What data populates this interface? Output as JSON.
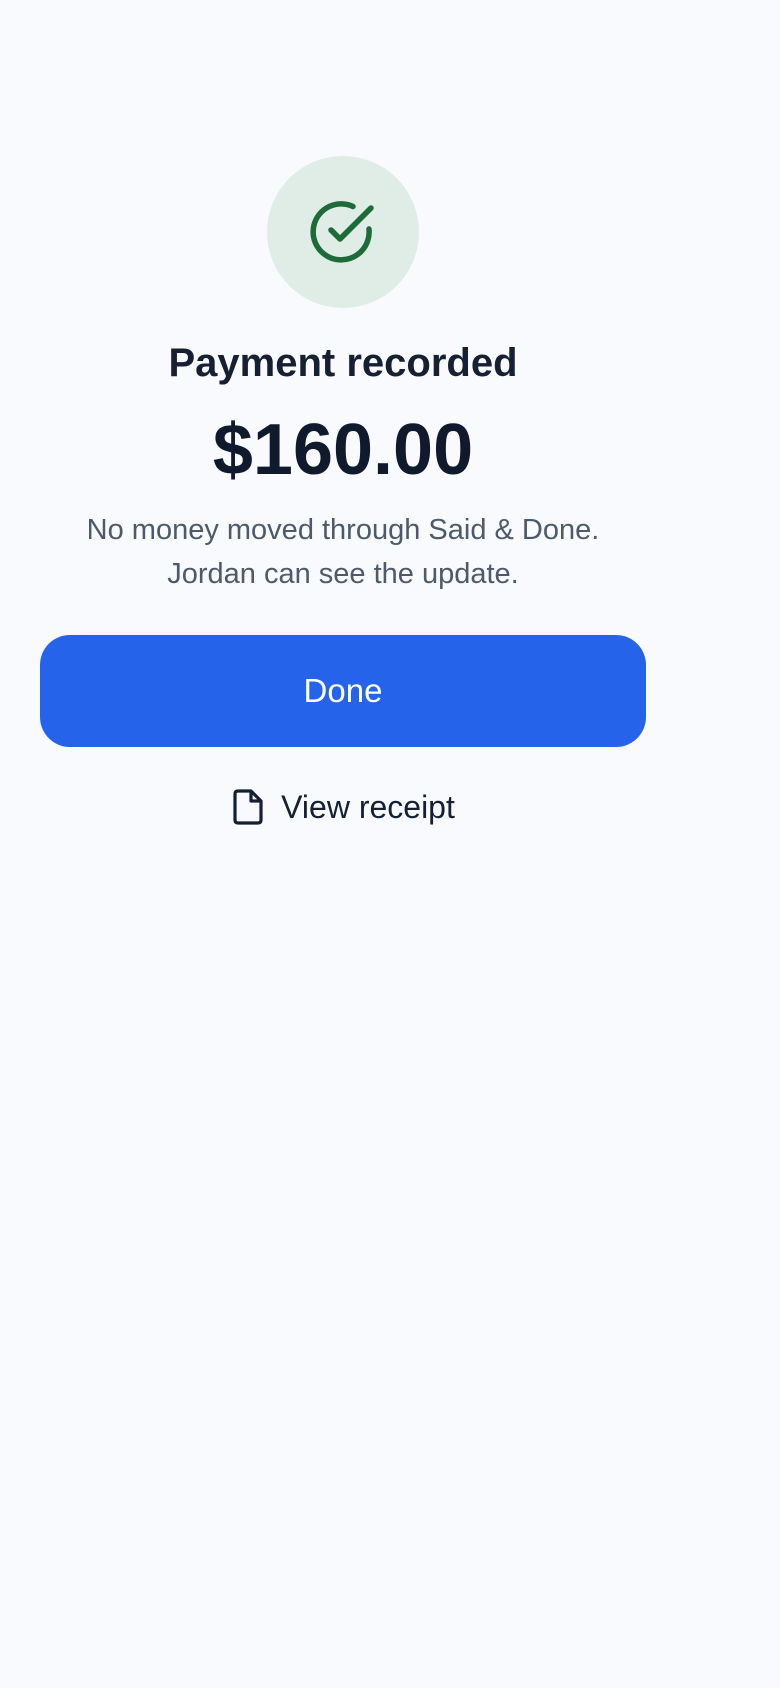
{
  "confirmation": {
    "icon": "check-circle-icon",
    "title": "Payment recorded",
    "amount": "$160.00",
    "description_line1": "No money moved through Said & Done.",
    "description_line2": "Jordan can see the update."
  },
  "actions": {
    "done_label": "Done",
    "receipt_icon": "file-icon",
    "receipt_label": "View receipt"
  },
  "colors": {
    "background": "#f8fafd",
    "accent": "#2563eb",
    "success": "#1e6b3a",
    "success_bg": "#e0ede6",
    "text_primary": "#152033",
    "text_secondary": "#4c5a6b"
  }
}
